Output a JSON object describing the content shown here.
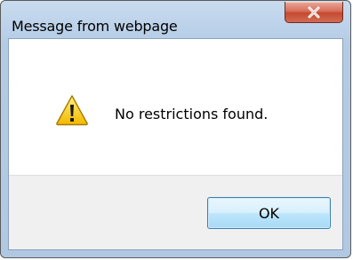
{
  "dialog": {
    "title": "Message from webpage",
    "message": "No restrictions found.",
    "ok_label": "OK",
    "close_icon": "close-icon",
    "message_icon": "warning-icon"
  },
  "colors": {
    "close_button": "#c44a31",
    "ok_button_border": "#3c7fb1",
    "warning_yellow": "#f5c400"
  }
}
